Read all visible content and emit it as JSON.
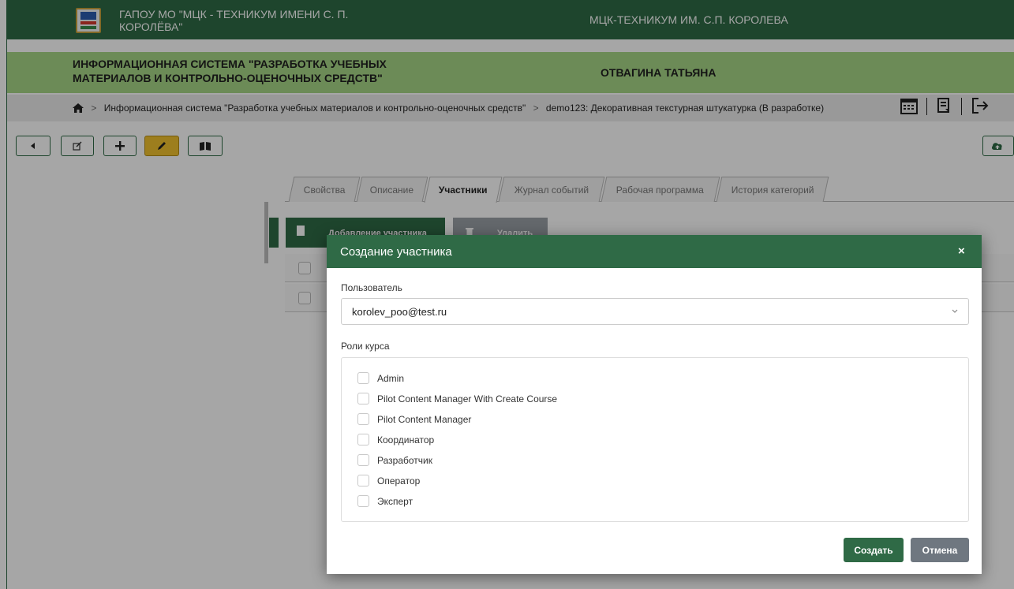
{
  "header": {
    "org_title": "ГАПОУ МО \"МЦК - ТЕХНИКУМ ИМЕНИ С. П. КОРОЛЁВА\"",
    "org_short": "МЦК-ТЕХНИКУМ ИМ. С.П. КОРОЛЕВА"
  },
  "subheader": {
    "system_title": "ИНФОРМАЦИОННАЯ СИСТЕМА \"РАЗРАБОТКА УЧЕБНЫХ МАТЕРИАЛОВ И КОНТРОЛЬНО-ОЦЕНОЧНЫХ СРЕДСТВ\"",
    "user_name": "ОТВАГИНА ТАТЬЯНА"
  },
  "breadcrumb": {
    "items": [
      "Информационная система \"Разработка учебных материалов и контрольно-оценочных средств\"",
      "demo123: Декоративная текстурная штукатурка (В разработке)"
    ],
    "separator": ">"
  },
  "tabs": [
    {
      "label": "Свойства"
    },
    {
      "label": "Описание"
    },
    {
      "label": "Участники"
    },
    {
      "label": "Журнал событий"
    },
    {
      "label": "Рабочая программа"
    },
    {
      "label": "История категорий"
    }
  ],
  "participants_toolbar": {
    "add_label": "Добавление участника",
    "delete_label": "Удалить"
  },
  "modal": {
    "title": "Создание участника",
    "close_icon": "×",
    "user_label": "Пользователь",
    "user_value": "korolev_poo@test.ru",
    "roles_label": "Роли курса",
    "roles": [
      "Admin",
      "Pilot Content Manager With Create Course",
      "Pilot Content Manager",
      "Координатор",
      "Разработчик",
      "Оператор",
      "Эксперт"
    ],
    "create_label": "Создать",
    "cancel_label": "Отмена"
  },
  "colors": {
    "primary_green": "#2f6a46",
    "light_green": "#a7d686",
    "active_yellow": "#f2c22e",
    "gray_button": "#6f7780"
  },
  "icons": [
    "home-icon",
    "chevron-right-icon",
    "calendar-icon",
    "document-icon",
    "logout-icon",
    "back-icon",
    "edit-icon",
    "plus-icon",
    "pencil-icon",
    "book-icon",
    "cloud-upload-icon",
    "file-icon",
    "trash-icon",
    "close-icon",
    "chevron-down-icon"
  ]
}
